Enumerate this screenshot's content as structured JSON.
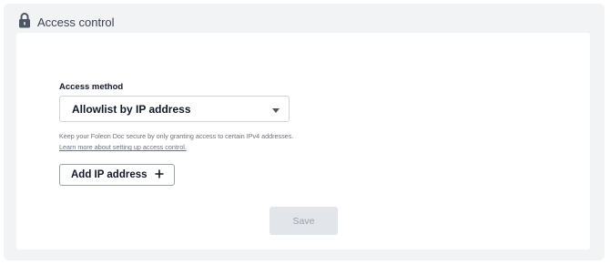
{
  "header": {
    "title": "Access control",
    "icon": "lock-icon"
  },
  "access_method": {
    "label": "Access method",
    "selected": "Allowlist by IP address"
  },
  "help": {
    "text": "Keep your Foleon Doc secure by only granting access to certain IPv4 addresses.",
    "link": "Learn more about setting up access control."
  },
  "buttons": {
    "add_ip": "Add IP address",
    "save": "Save"
  },
  "colors": {
    "outer_background": "#f2f3f5",
    "card_background": "#ffffff",
    "save_disabled_bg": "#e2e5e9",
    "save_disabled_text": "#9aa1ab"
  }
}
